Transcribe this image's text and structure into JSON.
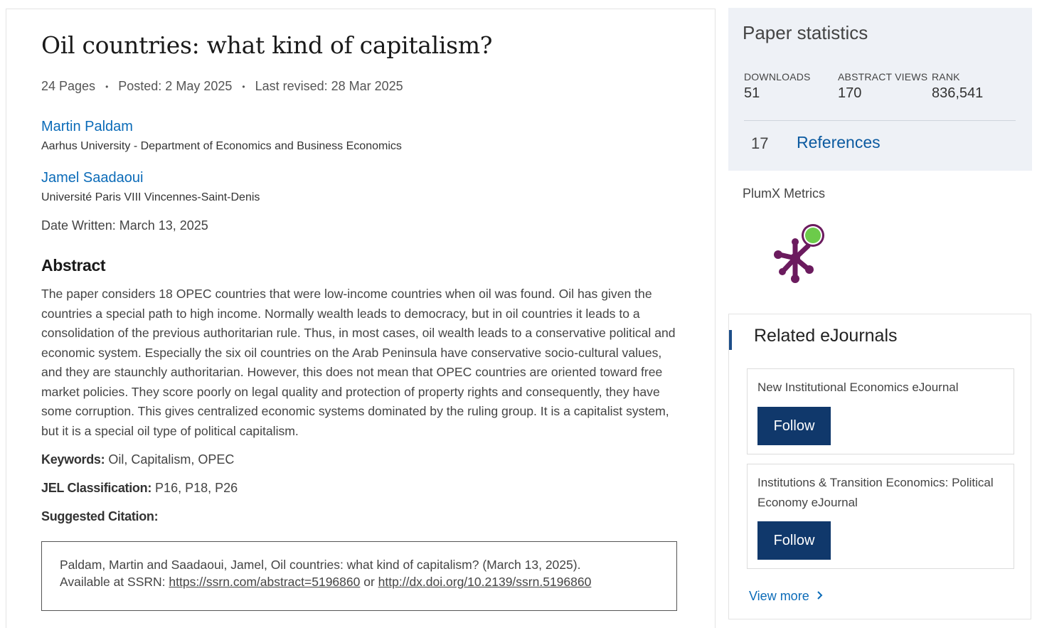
{
  "paper": {
    "title": "Oil countries: what kind of capitalism?",
    "pages": "24 Pages",
    "posted": "Posted: 2 May 2025",
    "last_revised": "Last revised: 28 Mar 2025",
    "authors": [
      {
        "name": "Martin Paldam",
        "affiliation": "Aarhus University - Department of Economics and Business Economics"
      },
      {
        "name": "Jamel Saadaoui",
        "affiliation": "Université Paris VIII Vincennes-Saint-Denis"
      }
    ],
    "date_written_label": "Date Written:",
    "date_written": "March 13, 2025",
    "abstract_heading": "Abstract",
    "abstract": "The paper considers 18 OPEC countries that were low-income countries when oil was found. Oil has given the countries a special path to high income. Normally wealth leads to democracy, but in oil countries it leads to a consolidation of the previous authoritarian rule. Thus, in most cases, oil wealth leads to a conservative political and economic system. Especially the six oil countries on the Arab Peninsula have conservative socio-cultural values, and they are staunchly authoritarian. However, this does not mean that OPEC countries are oriented toward free market policies. They score poorly on legal quality and protection of property rights and consequently, they have some corruption. This gives centralized economic systems dominated by the ruling group. It is a capitalist system, but it is a special oil type of political capitalism.",
    "keywords_label": "Keywords:",
    "keywords": "Oil, Capitalism, OPEC",
    "jel_label": "JEL Classification:",
    "jel": "P16, P18, P26",
    "citation_label": "Suggested Citation:",
    "citation_text": "Paldam, Martin and Saadaoui, Jamel, Oil countries: what kind of capitalism? (March 13, 2025).",
    "citation_available": "Available at SSRN:",
    "citation_link1": "https://ssrn.com/abstract=5196860",
    "citation_or": "or",
    "citation_link2": "http://dx.doi.org/10.2139/ssrn.5196860"
  },
  "stats": {
    "title": "Paper statistics",
    "downloads_label": "DOWNLOADS",
    "downloads": "51",
    "views_label": "ABSTRACT VIEWS",
    "views": "170",
    "rank_label": "RANK",
    "rank": "836,541",
    "references_count": "17",
    "references_label": "References"
  },
  "plumx": {
    "label": "PlumX Metrics",
    "logo_icon": "plumx-logo-icon"
  },
  "related": {
    "title": "Related eJournals",
    "journals": [
      {
        "name": "New Institutional Economics eJournal",
        "follow": "Follow"
      },
      {
        "name": "Institutions & Transition Economics: Political Economy eJournal",
        "follow": "Follow"
      }
    ],
    "view_more": "View more"
  },
  "colors": {
    "link": "#0b6bb8",
    "follow_button": "#10386b",
    "stats_bg": "#eef1f6",
    "plumx_purple": "#6b1b5e",
    "plumx_green": "#6ccb4a"
  }
}
